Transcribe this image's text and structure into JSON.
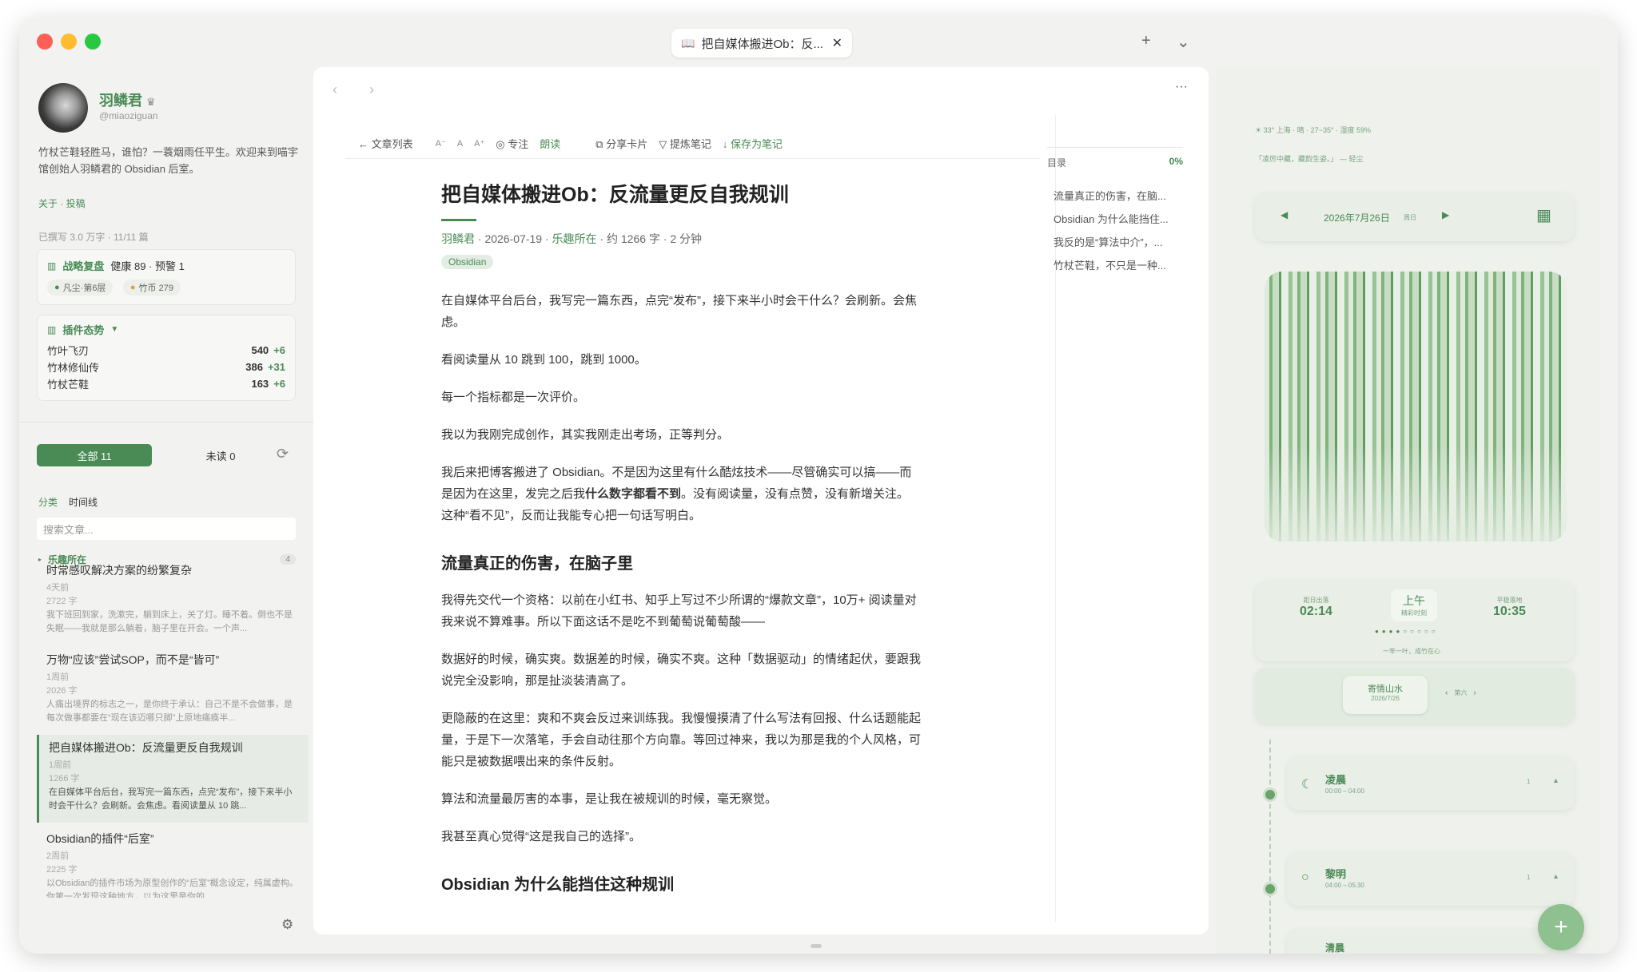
{
  "titlebar": {
    "tab_title": "把自媒体搬进Ob：反...",
    "new_tab": "+",
    "more": "⌄"
  },
  "profile": {
    "name": "羽鳞君",
    "handle": "@miaoziguan",
    "bio": "竹杖芒鞋轻胜马，谁怕？一蓑烟雨任平生。欢迎来到喵宇馆创始人羽鳞君的 Obsidian 后室。",
    "links": "关于 · 投稿",
    "written": "已撰写 3.0 万字 · 11/11 篇"
  },
  "strategy": {
    "title": "战略复盘",
    "health": "健康 89 · 预警 1",
    "pill1": "凡尘·第6层",
    "pill2": "竹币 279"
  },
  "plugins": {
    "title": "插件态势",
    "items": [
      {
        "name": "竹叶飞刃",
        "value": "540",
        "delta": "+6"
      },
      {
        "name": "竹林修仙传",
        "value": "386",
        "delta": "+31"
      },
      {
        "name": "竹杖芒鞋",
        "value": "163",
        "delta": "+6"
      }
    ]
  },
  "filters": {
    "all": "全部 11",
    "unread": "未读 0",
    "category": "分类",
    "timeline": "时间线",
    "search_placeholder": "搜索文章...",
    "group": "乐趣所在",
    "group_count": "4"
  },
  "articles": [
    {
      "title": "时常感叹解决方案的纷繁复杂",
      "time": "4天前",
      "words": "2722 字",
      "excerpt": "我下班回到家，洗漱完，躺到床上，关了灯。睡不着。倒也不是失眠——我就是那么躺着，脑子里在开会。一个声..."
    },
    {
      "title": "万物“应该”尝试SOP，而不是“皆可”",
      "time": "1周前",
      "words": "2026 字",
      "excerpt": "人痛出境界的标志之一，是你终于承认：自己不是不会做事，是每次做事都要在“现在该迈哪只脚”上原地痛痪半..."
    },
    {
      "title": "把自媒体搬进Ob：反流量更反自我规训",
      "time": "1周前",
      "words": "1266 字",
      "excerpt": "在自媒体平台后台，我写完一篇东西，点完“发布”，接下来半小时会干什么？会刷新。会焦虑。看阅读量从 10 跳..."
    },
    {
      "title": "Obsidian的插件“后室”",
      "time": "2周前",
      "words": "2225 字",
      "excerpt": "以Obsidian的插件市场为原型创作的“后室”概念设定，纯属虚构。你第一次发现这种地方，以为这里是你的..."
    }
  ],
  "toolbar": {
    "back": "文章列表",
    "a1": "A⁻",
    "a2": "A",
    "a3": "A⁺",
    "focus": "专注",
    "read": "朗读",
    "share": "分享卡片",
    "refine": "提炼笔记",
    "save": "保存为笔记"
  },
  "post": {
    "title": "把自媒体搬进Ob：反流量更反自我规训",
    "author": "羽鳞君",
    "date": "2026-07-19",
    "category": "乐趣所在",
    "stats": "约 1266 字 · 2 分钟",
    "tag": "Obsidian",
    "p1": "在自媒体平台后台，我写完一篇东西，点完“发布”，接下来半小时会干什么？会刷新。会焦虑。",
    "p2": "看阅读量从 10 跳到 100，跳到 1000。",
    "p3": "每一个指标都是一次评价。",
    "p4": "我以为我刚完成创作，其实我刚走出考场，正等判分。",
    "p5a": "我后来把博客搬进了 Obsidian。不是因为这里有什么酷炫技术——尽管确实可以搞——而是因为在这里，发完之后我",
    "p5b": "什么数字都看不到",
    "p5c": "。没有阅读量，没有点赞，没有新增关注。这种“看不见”，反而让我能专心把一句话写明白。",
    "h2": "流量真正的伤害，在脑子里",
    "p6": "我得先交代一个资格：以前在小红书、知乎上写过不少所谓的“爆款文章”，10万+ 阅读量对我来说不算难事。所以下面这话不是吃不到葡萄说葡萄酸——",
    "p7": "数据好的时候，确实爽。数据差的时候，确实不爽。这种「数据驱动」的情绪起伏，要跟我说完全没影响，那是扯淡装清高了。",
    "p8": "更隐蔽的在这里：爽和不爽会反过来训练我。我慢慢摸清了什么写法有回报、什么话题能起量，于是下一次落笔，手会自动往那个方向靠。等回过神来，我以为那是我的个人风格，可能只是被数据喂出来的条件反射。",
    "p9": "算法和流量最厉害的本事，是让我在被规训的时候，毫无察觉。",
    "p10": "我甚至真心觉得“这是我自己的选择”。",
    "h2b": "Obsidian 为什么能挡住这种规训"
  },
  "toc": {
    "label": "目录",
    "progress": "0%",
    "items": [
      "流量真正的伤害，在脑...",
      "Obsidian 为什么能挡住...",
      "我反的是“算法中介”，...",
      "竹杖芒鞋，不只是一种..."
    ]
  },
  "widget": {
    "weather": "☀ 33° 上海 · 晴 · 27~35° · 湿度 59%",
    "quote": "「凌厉中藏，藏韵生姿。」 — 轻尘",
    "date": "2026年7月26日",
    "weekday": "周日",
    "left_label": "距日出落",
    "left_time": "02:14",
    "center": "上午",
    "center_sub": "精彩时刻",
    "right_label": "平稳落地",
    "right_time": "10:35",
    "bottom_quote": "一竿一叶，成竹在心",
    "card_title": "寄情山水",
    "card_date": "2026/7/26",
    "nav_mid": "第六",
    "slots": [
      {
        "name": "凌晨",
        "time": "00:00 – 04:00",
        "count": "1"
      },
      {
        "name": "黎明",
        "time": "04:00 – 05:30",
        "count": "1"
      },
      {
        "name": "清晨",
        "time": ""
      }
    ],
    "fab": "+"
  },
  "colors": {
    "accent": "#4a8a55",
    "panel": "#eef1ec"
  }
}
